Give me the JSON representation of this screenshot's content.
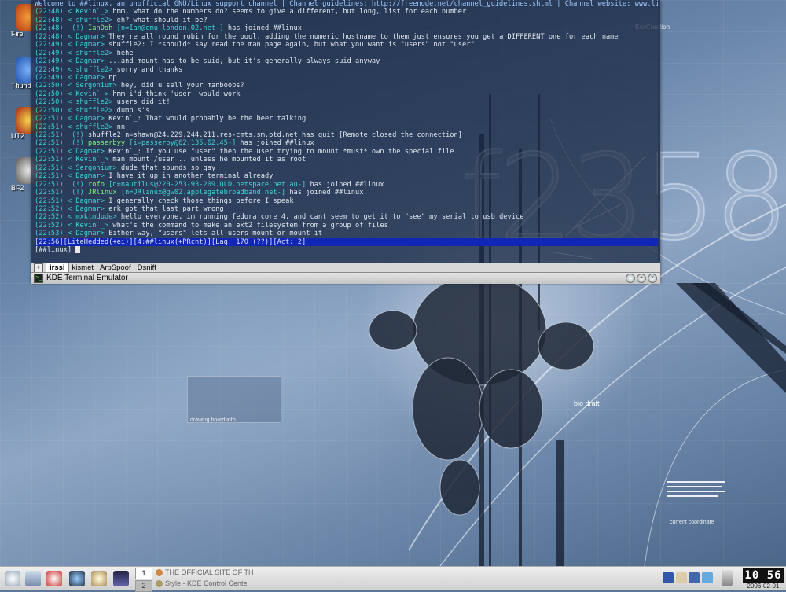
{
  "terminal": {
    "lines": [
      {
        "type": "topic",
        "text": "Welcome to ##linux, an unofficial GNU/Linux support channel | Channel guidelines: http://freenode.net/channel_guidelines.shtml | Channel website: www.linuxass"
      },
      {
        "type": "msg",
        "time": "(22:48)",
        "nick": "Kevin`_",
        "text": "hmm, what do the numbers do? seems to give a different, but long, list for each number"
      },
      {
        "type": "msg",
        "time": "(22:48)",
        "nick": "shuffle2",
        "text": "eh? what should it be?"
      },
      {
        "type": "join",
        "time": "(22:48)",
        "nick": "IanDoh",
        "host": "[n=Ian@emu.london.02.net-]",
        "text": "has joined ##linux"
      },
      {
        "type": "msg",
        "time": "(22:48)",
        "nick": "Dagmar",
        "text": "They're all round robin for the pool, adding the numeric hostname to them just ensures you get a DIFFERENT one for each name"
      },
      {
        "type": "msg",
        "time": "(22:49)",
        "nick": "Dagmar",
        "text": "shuffle2: I *should* say read the man page again, but what you want is \"users\" not \"user\""
      },
      {
        "type": "msg",
        "time": "(22:49)",
        "nick": "shuffle2",
        "text": "hehe"
      },
      {
        "type": "msg",
        "time": "(22:49)",
        "nick": "Dagmar",
        "text": "...and mount has to be suid, but it's generally always suid anyway"
      },
      {
        "type": "msg",
        "time": "(22:49)",
        "nick": "shuffle2",
        "text": "sorry and thanks"
      },
      {
        "type": "msg",
        "time": "(22:49)",
        "nick": "Dagmar",
        "text": "np"
      },
      {
        "type": "msg",
        "time": "(22:50)",
        "nick": "Sergonium",
        "text": "hey, did u sell your manboobs?"
      },
      {
        "type": "msg",
        "time": "(22:50)",
        "nick": "Kevin`_",
        "text": "hmm i'd think 'user' would work"
      },
      {
        "type": "msg",
        "time": "(22:50)",
        "nick": "shuffle2",
        "text": "users did it!"
      },
      {
        "type": "msg",
        "time": "(22:50)",
        "nick": "shuffle2",
        "text": "dumb s's"
      },
      {
        "type": "msg",
        "time": "(22:51)",
        "nick": "Dagmar",
        "text": "Kevin`_: That would probably be the beer talking"
      },
      {
        "type": "msg",
        "time": "(22:51)",
        "nick": "shuffle2",
        "text": "nn"
      },
      {
        "type": "quit",
        "time": "(22:51)",
        "nick": "shuffle2",
        "host": "n=shawn@24.229.244.211.res-cmts.sm.ptd.net",
        "text": "has quit [Remote closed the connection]"
      },
      {
        "type": "join",
        "time": "(22:51)",
        "nick": "passerbyy",
        "host": "[i=passerby@62.135.62.45-]",
        "text": "has joined ##linux"
      },
      {
        "type": "msg",
        "time": "(22:51)",
        "nick": "Dagmar",
        "text": "Kevin`_: If you use \"user\" then the user trying to mount *must* own the special file"
      },
      {
        "type": "msg",
        "time": "(22:51)",
        "nick": "Kevin`_",
        "text": "man mount /user .. unless he mounted it as root"
      },
      {
        "type": "msg",
        "time": "(22:51)",
        "nick": "Sergonium",
        "text": "dude that sounds so gay"
      },
      {
        "type": "msg",
        "time": "(22:51)",
        "nick": "Dagmar",
        "text": "I have it up in another terminal already"
      },
      {
        "type": "join",
        "time": "(22:51)",
        "nick": "rofo",
        "host": "[n=nautilus@220-253-93-209.QLD.netspace.net.au-]",
        "text": "has joined ##linux"
      },
      {
        "type": "join",
        "time": "(22:51)",
        "nick": "JRlinux",
        "host": "[n=JRlinux@gw02.applegatebroadband.net-]",
        "text": "has joined ##linux"
      },
      {
        "type": "msg",
        "time": "(22:51)",
        "nick": "Dagmar",
        "text": "I generally check those things before I speak"
      },
      {
        "type": "msg",
        "time": "(22:52)",
        "nick": "Dagmar",
        "text": "erk got that last part wrong"
      },
      {
        "type": "msg",
        "time": "(22:52)",
        "nick": "mxktmdude",
        "text": "hello everyone, im running fedora core 4, and cant seem to get it to \"see\" my serial to usb device"
      },
      {
        "type": "msg",
        "time": "(22:52)",
        "nick": "Kevin`_",
        "text": "what's the command to make an ext2 filesystem from a group of files"
      },
      {
        "type": "msg",
        "time": "(22:53)",
        "nick": "Dagmar",
        "text": "Either way, \"users\" lets all users mount or mount it"
      }
    ],
    "statusbar": "[22:56][LiteHedded(+ei)][4:##linux(+PRcnt)][Lag: 170 (??)][Act: 2]",
    "input": "[##linux]",
    "tabs": [
      "irssi",
      "kismet",
      "ArpSpoof",
      "Dsniff"
    ],
    "active_tab": 0,
    "title": "KDE Terminal Emulator"
  },
  "desktop": {
    "icons": [
      {
        "label": "Fire"
      },
      {
        "label": "Thund"
      },
      {
        "label": "UT2"
      },
      {
        "label": "BF2"
      }
    ]
  },
  "wallpaper": {
    "bignum": "f2358",
    "bio": "bio draft",
    "caption_1": "ExoCreation",
    "caption_2": "current coordinate",
    "caption_3": "drawing board info"
  },
  "taskbar": {
    "desktops": [
      "1",
      "2"
    ],
    "tasks": [
      {
        "label": "THE OFFICIAL SITE OF TH"
      },
      {
        "label": "Style - KDE Control Cente"
      }
    ],
    "clock_time": "10 56",
    "clock_date": "2006-02-01"
  },
  "colors": {
    "irc_time": "#3ed3d3",
    "irc_join_nick": "#7bf07b",
    "statusbar_bg": "#1226b5"
  }
}
